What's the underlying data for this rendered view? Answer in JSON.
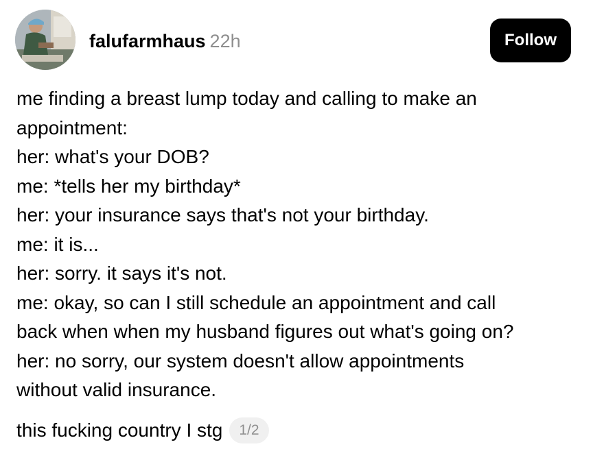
{
  "header": {
    "username": "falufarmhaus",
    "timestamp": "22h",
    "follow_label": "Follow"
  },
  "post": {
    "lines": [
      "me finding a breast lump today and calling to make an",
      "appointment:",
      "her: what's your DOB?",
      "me: *tells her my birthday*",
      "her: your insurance says that's not your birthday.",
      "me: it is...",
      "her: sorry. it says it's not.",
      "me: okay, so can I still schedule an appointment and call",
      "back when when my husband figures out what's going on?",
      "her: no sorry, our system doesn't allow appointments",
      "without valid insurance."
    ],
    "footer_text": "this fucking country I stg",
    "page_indicator": "1/2"
  }
}
